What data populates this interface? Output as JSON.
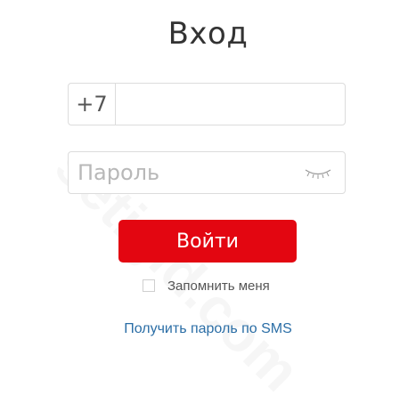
{
  "title": "Вход",
  "phone": {
    "prefix": "+7",
    "value": ""
  },
  "password": {
    "placeholder": "Пароль",
    "value": ""
  },
  "login_button": "Войти",
  "remember_me": {
    "label": "Запомнить меня",
    "checked": false
  },
  "sms_link": "Получить пароль по SMS",
  "watermark": "setigid.com",
  "icons": {
    "eye": "eye-closed-icon"
  },
  "colors": {
    "accent": "#e30611",
    "link": "#2b6ea6"
  }
}
